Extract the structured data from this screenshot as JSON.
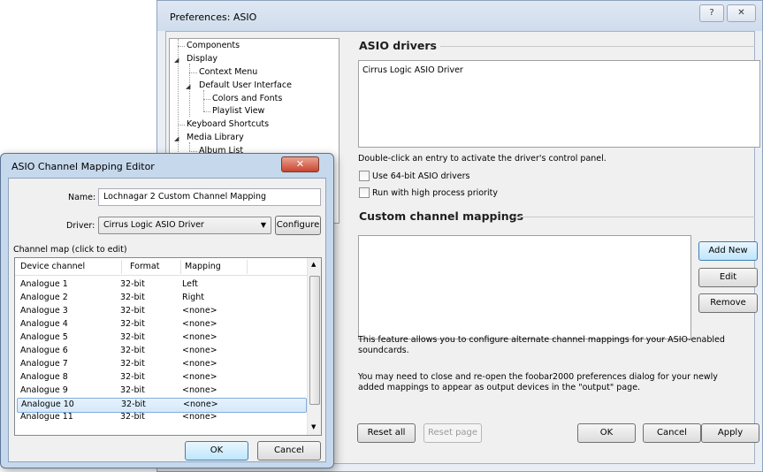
{
  "prefs": {
    "title": "Preferences: ASIO",
    "help_glyph": "?",
    "close_glyph": "✕",
    "tree": [
      {
        "label": "Components"
      },
      {
        "label": "Display"
      },
      {
        "label": "Context Menu"
      },
      {
        "label": "Default User Interface"
      },
      {
        "label": "Colors and Fonts"
      },
      {
        "label": "Playlist View"
      },
      {
        "label": "Keyboard Shortcuts"
      },
      {
        "label": "Media Library"
      },
      {
        "label": "Album List"
      }
    ],
    "asio_section": "ASIO drivers",
    "drivers": [
      "Cirrus Logic ASIO Driver"
    ],
    "driver_hint": "Double-click an entry to activate the driver's control panel.",
    "use_64bit_label": "Use 64-bit ASIO drivers",
    "high_priority_label": "Run with high process priority",
    "use_64bit_checked": false,
    "high_priority_checked": false,
    "custom_section": "Custom channel mappings",
    "add_new": "Add New",
    "edit": "Edit",
    "remove": "Remove",
    "info1_line1": "This feature allows you to configure alternate channel mappings for your ASIO-enabled",
    "info1_line2": "soundcards.",
    "info2_line1": "You may need to close and re-open the foobar2000 preferences dialog for your newly",
    "info2_line2": "added mappings to appear as output devices in the \"output\" page.",
    "reset_all": "Reset all",
    "reset_page": "Reset page",
    "ok": "OK",
    "cancel": "Cancel",
    "apply": "Apply"
  },
  "mapping_editor": {
    "title": "ASIO Channel Mapping Editor",
    "close_glyph": "✕",
    "name_label": "Name:",
    "name_value": "Lochnagar 2 Custom Channel Mapping",
    "driver_label": "Driver:",
    "driver_value": "Cirrus Logic ASIO Driver",
    "configure": "Configure",
    "map_caption": "Channel map (click to edit)",
    "columns": [
      "Device channel",
      "Format",
      "Mapping"
    ],
    "rows": [
      {
        "channel": "Analogue 1",
        "format": "32-bit",
        "mapping": "Left"
      },
      {
        "channel": "Analogue 2",
        "format": "32-bit",
        "mapping": "Right"
      },
      {
        "channel": "Analogue 3",
        "format": "32-bit",
        "mapping": "<none>"
      },
      {
        "channel": "Analogue 4",
        "format": "32-bit",
        "mapping": "<none>"
      },
      {
        "channel": "Analogue 5",
        "format": "32-bit",
        "mapping": "<none>"
      },
      {
        "channel": "Analogue 6",
        "format": "32-bit",
        "mapping": "<none>"
      },
      {
        "channel": "Analogue 7",
        "format": "32-bit",
        "mapping": "<none>"
      },
      {
        "channel": "Analogue 8",
        "format": "32-bit",
        "mapping": "<none>"
      },
      {
        "channel": "Analogue 9",
        "format": "32-bit",
        "mapping": "<none>"
      },
      {
        "channel": "Analogue 10",
        "format": "32-bit",
        "mapping": "<none>"
      },
      {
        "channel": "Analogue 11",
        "format": "32-bit",
        "mapping": "<none>"
      }
    ],
    "selected_row": "Analogue 10",
    "ok": "OK",
    "cancel": "Cancel"
  }
}
